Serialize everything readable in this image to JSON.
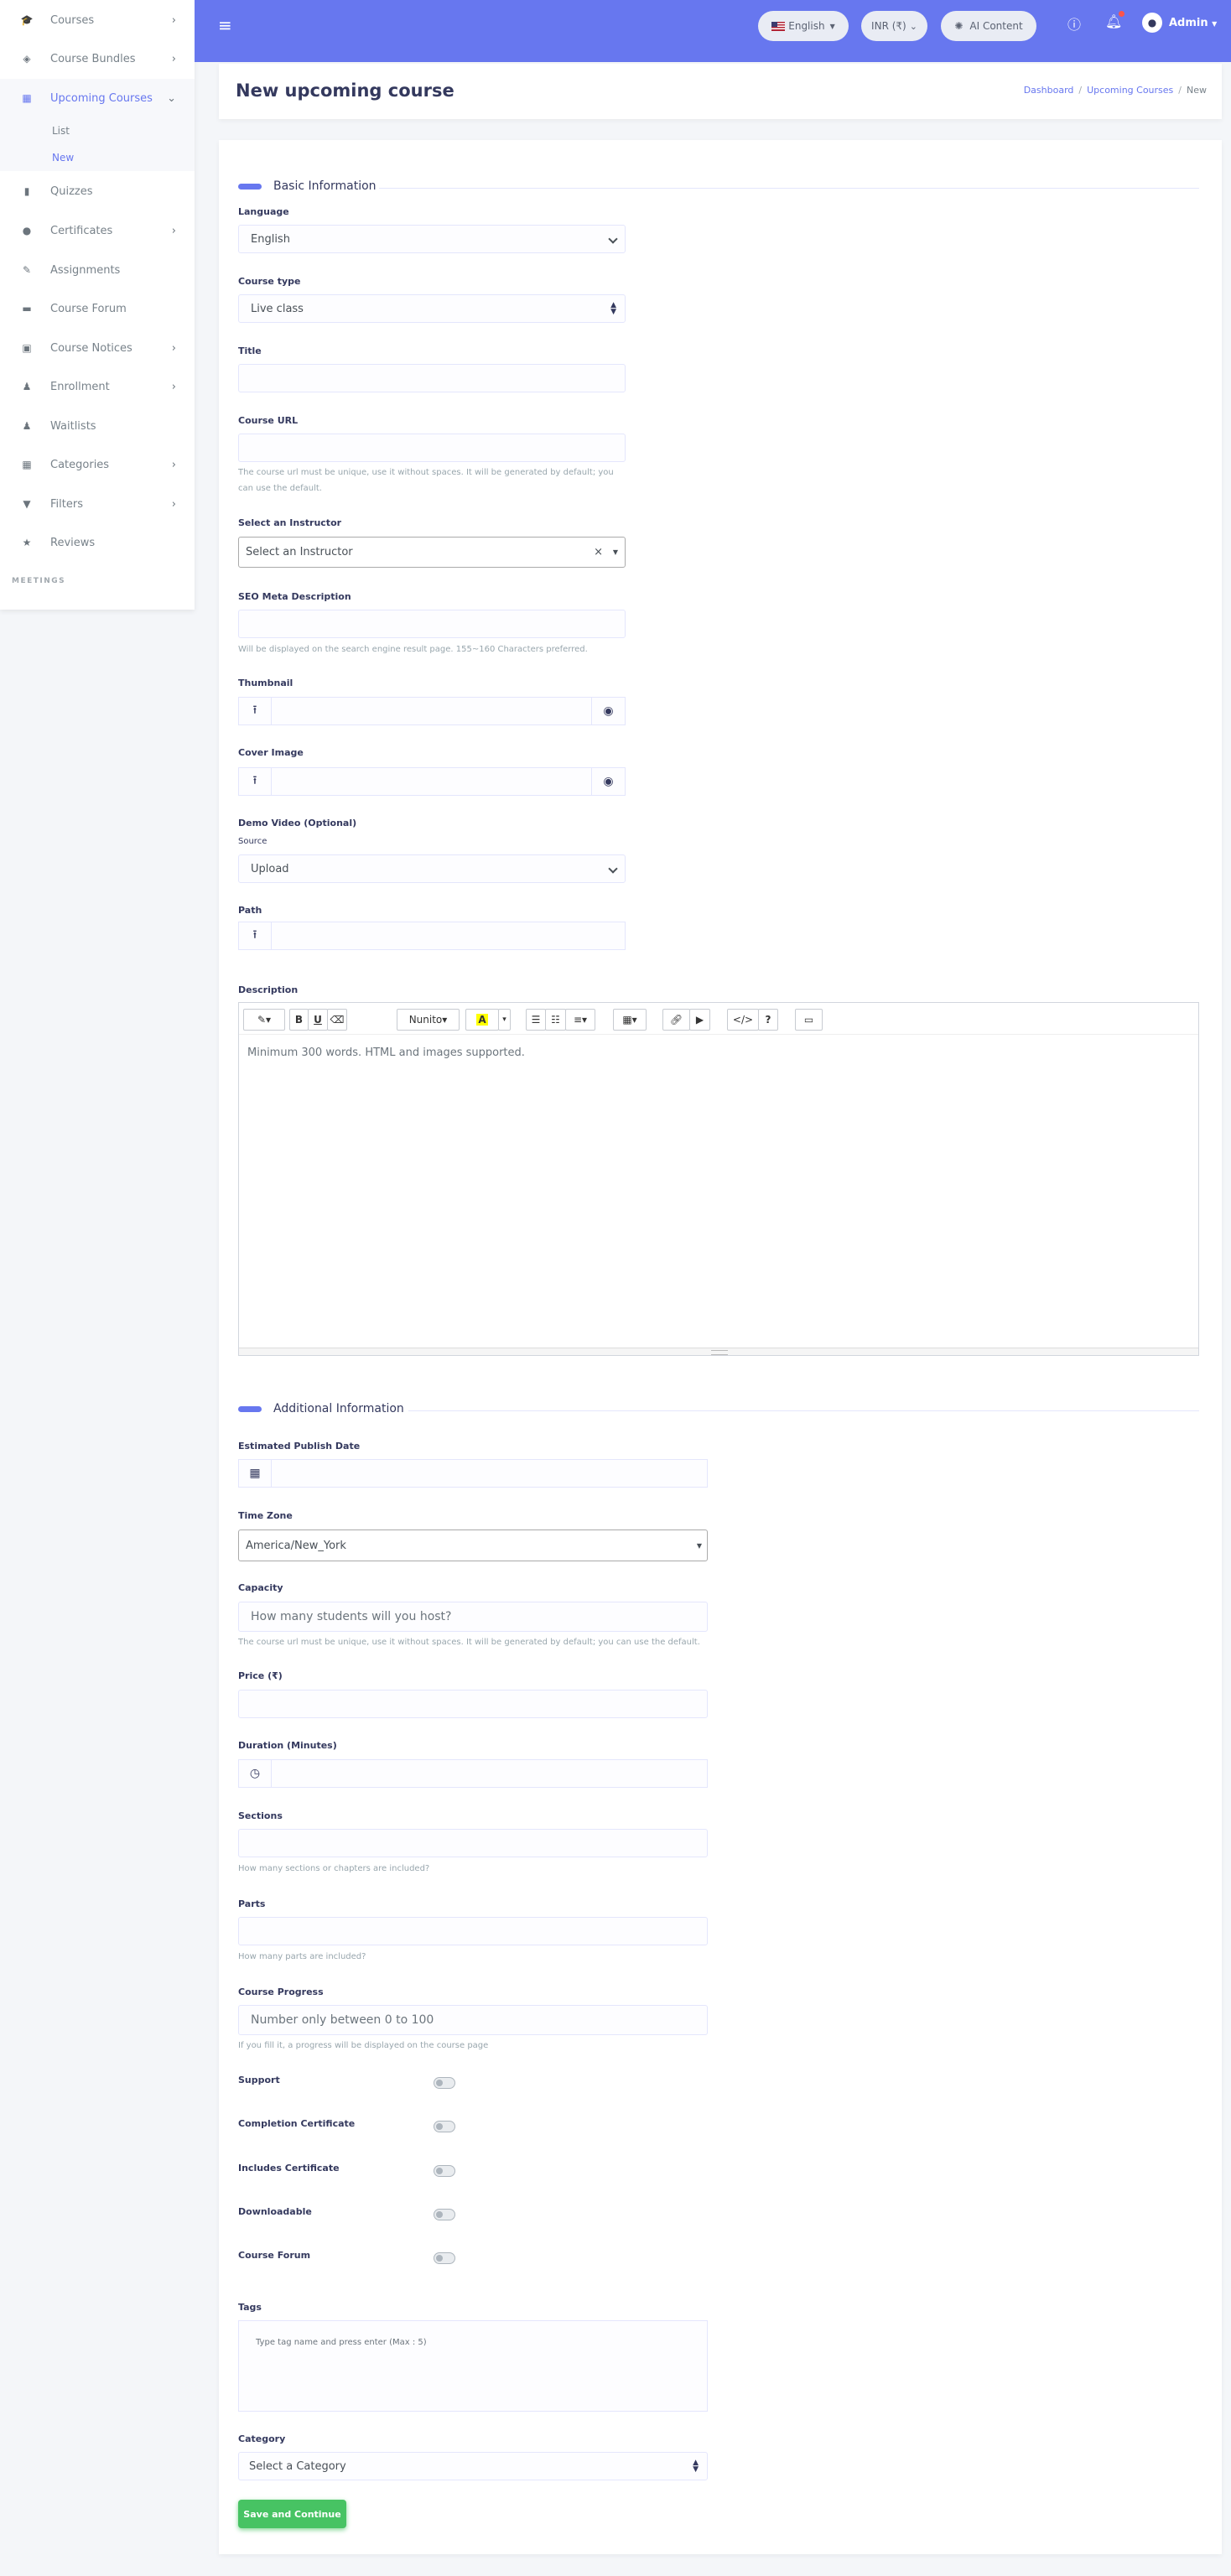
{
  "sidebar": {
    "items": [
      {
        "label": "Courses",
        "icon": "graduation-cap-icon",
        "has_arrow": true
      },
      {
        "label": "Course Bundles",
        "icon": "boxes-icon",
        "has_arrow": true
      },
      {
        "label": "Upcoming Courses",
        "icon": "calendar-icon",
        "has_arrow": true,
        "active": true
      },
      {
        "label": "Quizzes",
        "icon": "file-icon"
      },
      {
        "label": "Certificates",
        "icon": "certificate-icon",
        "has_arrow": true
      },
      {
        "label": "Assignments",
        "icon": "pen-icon"
      },
      {
        "label": "Course Forum",
        "icon": "comment-icon"
      },
      {
        "label": "Course Notices",
        "icon": "clipboard-check-icon",
        "has_arrow": true
      },
      {
        "label": "Enrollment",
        "icon": "user-plus-icon",
        "has_arrow": true
      },
      {
        "label": "Waitlists",
        "icon": "user-clock-icon"
      },
      {
        "label": "Categories",
        "icon": "grid-icon",
        "has_arrow": true
      },
      {
        "label": "Filters",
        "icon": "filter-icon",
        "has_arrow": true
      },
      {
        "label": "Reviews",
        "icon": "star-icon"
      }
    ],
    "sub_items": {
      "list": "List",
      "new": "New"
    },
    "section_header": "MEETINGS"
  },
  "topbar": {
    "language": "English",
    "currency": "INR (₹)",
    "ai_content": "AI Content",
    "user": "Admin",
    "accent_color": "#6777ef"
  },
  "header": {
    "title": "New upcoming course",
    "breadcrumb": [
      "Dashboard",
      "Upcoming Courses",
      "New"
    ]
  },
  "basic": {
    "section_title": "Basic Information",
    "language_label": "Language",
    "language_value": "English",
    "course_type_label": "Course type",
    "course_type_value": "Live class",
    "title_label": "Title",
    "url_label": "Course URL",
    "url_help_1": "The course url must be unique, use it without spaces. It will be generated by default; you",
    "url_help_2": "can use the default.",
    "instructor_label": "Select an Instructor",
    "instructor_value": "Select an Instructor",
    "seo_label": "SEO Meta Description",
    "seo_help": "Will be displayed on the search engine result page. 155~160 Characters preferred.",
    "thumbnail_label": "Thumbnail",
    "cover_label": "Cover Image",
    "demo_label": "Demo Video (Optional)",
    "source_label": "Source",
    "source_value": "Upload",
    "path_label": "Path",
    "description_label": "Description",
    "description_placeholder": "Minimum 300 words. HTML and images supported.",
    "editor_font": "Nunito"
  },
  "additional": {
    "section_title": "Additional Information",
    "publish_label": "Estimated Publish Date",
    "timezone_label": "Time Zone",
    "timezone_value": "America/New_York",
    "capacity_label": "Capacity",
    "capacity_placeholder": "How many students will you host?",
    "capacity_help": "The course url must be unique, use it without spaces. It will be generated by default; you can use the default.",
    "price_label": "Price (₹)",
    "duration_label": "Duration (Minutes)",
    "sections_label": "Sections",
    "sections_help": "How many sections or chapters are included?",
    "parts_label": "Parts",
    "parts_help": "How many parts are included?",
    "progress_label": "Course Progress",
    "progress_placeholder": "Number only between 0 to 100",
    "progress_help": "If you fill it, a progress will be displayed on the course page",
    "toggles": [
      "Support",
      "Completion Certificate",
      "Includes Certificate",
      "Downloadable",
      "Course Forum"
    ],
    "tags_label": "Tags",
    "tags_placeholder": "Type tag name and press enter (Max : 5)",
    "category_label": "Category",
    "category_value": "Select a Category",
    "save_button": "Save and Continue"
  }
}
